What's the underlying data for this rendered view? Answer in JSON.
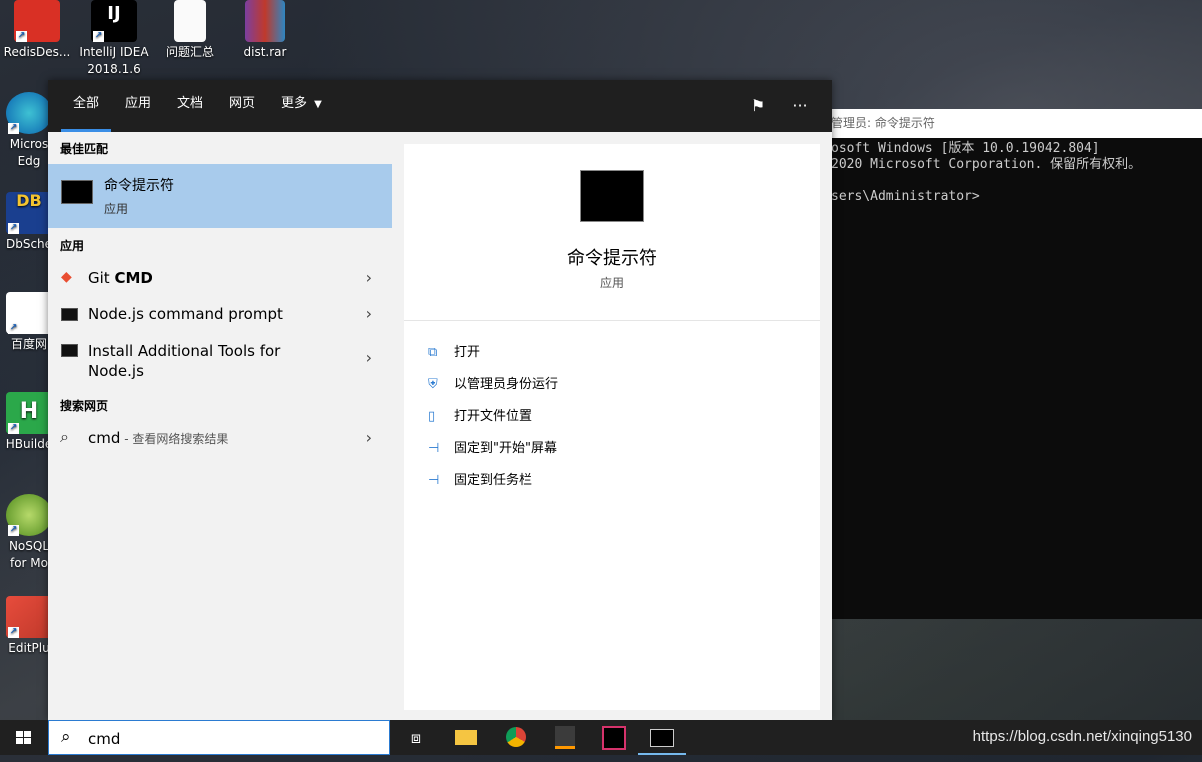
{
  "desktop": {
    "icons": [
      {
        "label": "RedisDes..."
      },
      {
        "label": "IntelliJ IDEA\n2018.1.6"
      },
      {
        "label": "问题汇总"
      },
      {
        "label": "dist.rar"
      },
      {
        "label": "Micros\nEdg"
      },
      {
        "label": "DbSche"
      },
      {
        "label": "百度网"
      },
      {
        "label": "HBuilde"
      },
      {
        "label": "NoSQL\nfor Mo"
      },
      {
        "label": "EditPlu"
      }
    ]
  },
  "terminal": {
    "title": "管理员: 命令提示符",
    "lines": [
      "osoft Windows [版本 10.0.19042.804]",
      "2020 Microsoft Corporation. 保留所有权利。",
      "",
      "sers\\Administrator>"
    ]
  },
  "search_panel": {
    "tabs": [
      {
        "label": "全部"
      },
      {
        "label": "应用"
      },
      {
        "label": "文档"
      },
      {
        "label": "网页"
      },
      {
        "label": "更多"
      }
    ],
    "best_match": {
      "section": "最佳匹配",
      "title": "命令提示符",
      "subtitle": "应用"
    },
    "apps": {
      "section": "应用",
      "items": [
        {
          "prefix": "Git ",
          "bold": "CMD"
        },
        {
          "prefix": "Node.js command prompt",
          "bold": ""
        },
        {
          "prefix": "Install Additional Tools for\nNode.js",
          "bold": ""
        }
      ]
    },
    "web": {
      "section": "搜索网页",
      "query": "cmd",
      "hint": " - 查看网络搜索结果"
    },
    "detail": {
      "title": "命令提示符",
      "subtitle": "应用",
      "actions": [
        {
          "label": "打开",
          "icon": "open-icon"
        },
        {
          "label": "以管理员身份运行",
          "icon": "shield-icon"
        },
        {
          "label": "打开文件位置",
          "icon": "file-location-icon"
        },
        {
          "label": "固定到\"开始\"屏幕",
          "icon": "pin-icon"
        },
        {
          "label": "固定到任务栏",
          "icon": "pin-icon"
        }
      ]
    }
  },
  "taskbar": {
    "search_value": "cmd",
    "watermark": "https://blog.csdn.net/xinqing5130"
  }
}
